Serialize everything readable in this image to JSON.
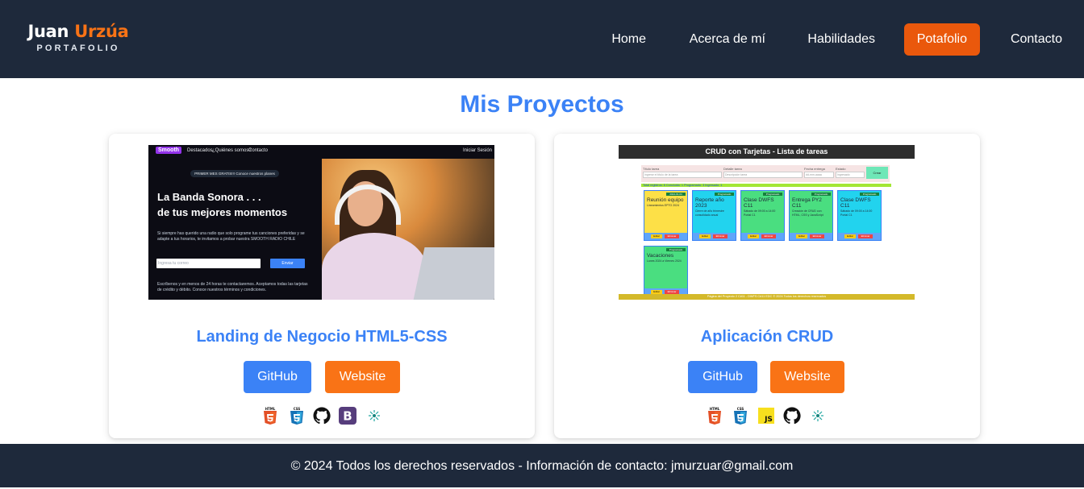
{
  "brand": {
    "first": "Juan",
    "last": "Urzúa",
    "subtitle": "PORTAFOLIO"
  },
  "nav": {
    "items": [
      "Home",
      "Acerca de mí",
      "Habilidades",
      "Potafolio",
      "Contacto"
    ],
    "active": "Potafolio"
  },
  "main": {
    "title": "Mis Proyectos",
    "projects": [
      {
        "title": "Landing de Negocio HTML5-CSS",
        "github_label": "GitHub",
        "website_label": "Website",
        "tech_icons": [
          "html5-icon",
          "css3-icon",
          "github-icon",
          "bootstrap-icon",
          "netlify-icon"
        ],
        "thumbnail": {
          "brand": "Smooth",
          "nav_items": [
            "Destacados",
            "¿Quiénes somos?",
            "Contacto"
          ],
          "login": "Iniciar Sesión",
          "pill": "PRIMER MES GRATIS!!! Conoce nuestros planes",
          "headline_1": "La Banda Sonora . . .",
          "headline_2": "de tus mejores momentos",
          "paragraph": "Si siempre has querido una radio que solo programe tus canciones preferidas y se adapte a tus horarios, te invitamos a probar nuestra SMOOTH RADIO CHILE",
          "email_placeholder": "Ingresa tu correo",
          "send_label": "Enviar",
          "footer": "Escríbenos y en menos de 24 horas te contactaremos. Aceptamos todas las tarjetas de crédito y débito. Conoce nuestros términos y condiciones."
        }
      },
      {
        "title": "Aplicación CRUD",
        "github_label": "GitHub",
        "website_label": "Website",
        "tech_icons": [
          "html5-icon",
          "css3-icon",
          "javascript-icon",
          "github-icon",
          "netlify-icon"
        ],
        "thumbnail": {
          "header": "CRUD con Tarjetas - Lista de tareas",
          "labels": [
            "Título tarea",
            "Detalle tarea",
            "Fecha entrega",
            "Estado"
          ],
          "placeholders": [
            "Ingrese el título de la tarea",
            "Descripción tarea",
            "dd-mm-aaaa",
            "Ingresado"
          ],
          "create_label": "Crear",
          "totals": "Total registros: 6 Concluido: 1 Programado: 3 Ingresado: 1",
          "cards": [
            {
              "title": "Reunión equipo",
              "desc": "Lineamientos EPTO 2024",
              "badge": "2024-01-04",
              "color": "#fde047"
            },
            {
              "title": "Reporte año 2023",
              "desc": "Cierre de año trimestre consolidado anual",
              "badge": "Programado",
              "color": "#22d3ee"
            },
            {
              "title": "Clase DWFS C11",
              "desc": "Sábado de 09:00 a 14:00 Portal C1",
              "badge": "Programado",
              "color": "#4ade80"
            },
            {
              "title": "Entrega PY2 C11",
              "desc": "Creación de CRUD con HTML, CSS y JavaScript",
              "badge": "Programado",
              "color": "#4ade80"
            },
            {
              "title": "Clase DWFS C11",
              "desc": "Sábado de 09:00 a 14:00 Portal C1",
              "badge": "Programado",
              "color": "#22d3ee"
            },
            {
              "title": "Vacaciones",
              "desc": "Lunes 2024 a Viernes 2024",
              "badge": "Programado",
              "color": "#4ade80"
            }
          ],
          "edit_label": "Editar",
          "delete_label": "Eliminar",
          "footer": "Página del Proyecto 2 C#11 - DWFS C#11 EDC © 2024 Todos los derechos reservados"
        }
      }
    ]
  },
  "footer": {
    "text": "© 2024 Todos los derechos reservados - Información de contacto: jmurzuar@gmail.com"
  },
  "colors": {
    "header_bg": "#1e293b",
    "accent_orange": "#f97316",
    "accent_blue": "#3b82f6"
  }
}
